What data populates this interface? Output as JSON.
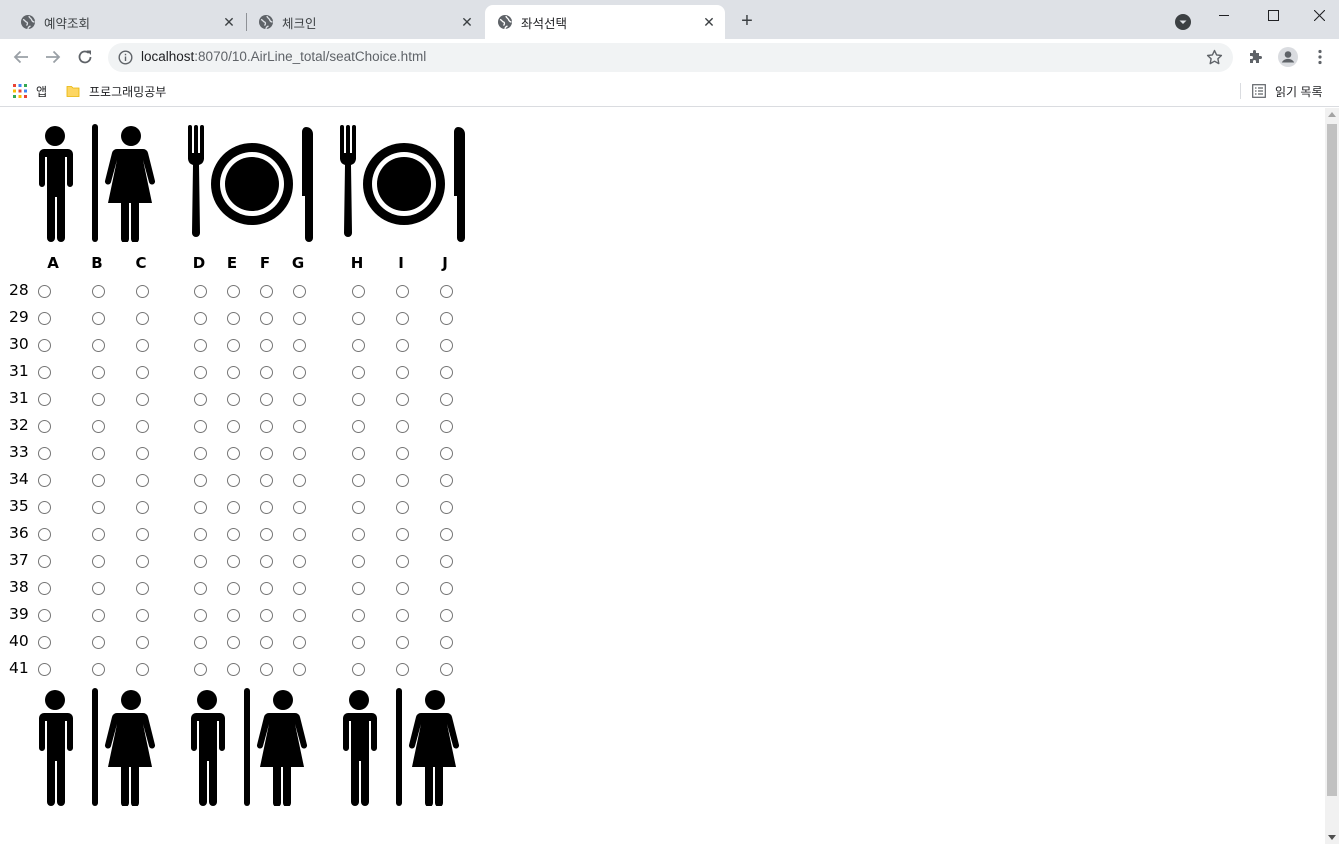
{
  "browser": {
    "tabs": [
      {
        "title": "예약조회",
        "active": false
      },
      {
        "title": "체크인",
        "active": false
      },
      {
        "title": "좌석선택",
        "active": true
      }
    ],
    "url_host": "localhost",
    "url_path": ":8070/10.AirLine_total/seatChoice.html",
    "bookmarks": {
      "apps_label": "앱",
      "folder_label": "프로그래밍공부",
      "reading_list_label": "읽기 목록"
    }
  },
  "seat_map": {
    "columns": [
      "A",
      "B",
      "C",
      "D",
      "E",
      "F",
      "G",
      "H",
      "I",
      "J"
    ],
    "rows": [
      "28",
      "29",
      "30",
      "31",
      "31",
      "32",
      "33",
      "34",
      "35",
      "36",
      "37",
      "38",
      "39",
      "40",
      "41"
    ],
    "top_facilities": [
      "restroom-icon",
      "dining-icon",
      "dining-icon"
    ],
    "bottom_facilities": [
      "restroom-icon",
      "restroom-icon",
      "restroom-icon"
    ]
  },
  "colors": {
    "tab_strip": "#dee1e6",
    "omnibox": "#f1f3f4",
    "icon": "#000000"
  }
}
